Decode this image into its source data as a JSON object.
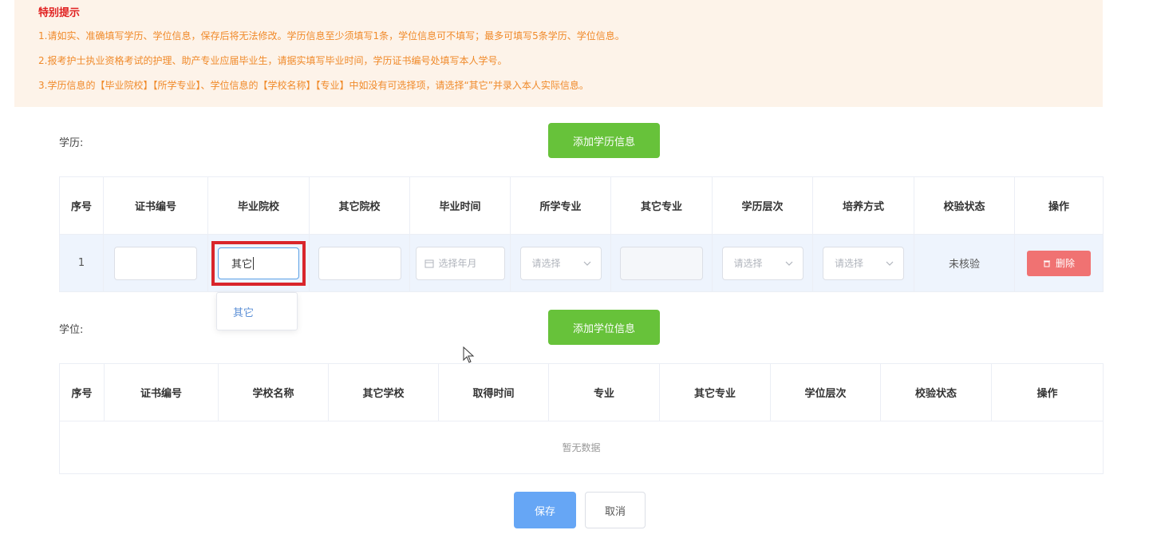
{
  "notice": {
    "title": "特别提示",
    "lines": [
      "1.请如实、准确填写学历、学位信息，保存后将无法修改。学历信息至少须填写1条，学位信息可不填写；最多可填写5条学历、学位信息。",
      "2.报考护士执业资格考试的护理、助产专业应届毕业生，请据实填写毕业时间，学历证书编号处填写本人学号。",
      "3.学历信息的【毕业院校】【所学专业】、学位信息的【学校名称】【专业】中如没有可选择项，请选择“其它”并录入本人实际信息。"
    ]
  },
  "education": {
    "label": "学历:",
    "add_button": "添加学历信息",
    "columns": [
      "序号",
      "证书编号",
      "毕业院校",
      "其它院校",
      "毕业时间",
      "所学专业",
      "其它专业",
      "学历层次",
      "培养方式",
      "校验状态",
      "操作"
    ],
    "row": {
      "index": "1",
      "school_value": "其它",
      "date_placeholder": "选择年月",
      "select_placeholder": "请选择",
      "status": "未核验",
      "delete_label": "删除"
    },
    "dropdown_option": "其它"
  },
  "degree": {
    "label": "学位:",
    "add_button": "添加学位信息",
    "columns": [
      "序号",
      "证书编号",
      "学校名称",
      "其它学校",
      "取得时间",
      "专业",
      "其它专业",
      "学位层次",
      "校验状态",
      "操作"
    ],
    "empty_text": "暂无数据"
  },
  "actions": {
    "save": "保存",
    "cancel": "取消"
  },
  "colors": {
    "notice_bg": "#fdf3e9",
    "notice_title": "#e02020",
    "notice_text": "#f08a2a",
    "green": "#67c23a",
    "primary": "#66a6f5",
    "danger": "#f07272",
    "highlight_box": "#d9252a"
  }
}
